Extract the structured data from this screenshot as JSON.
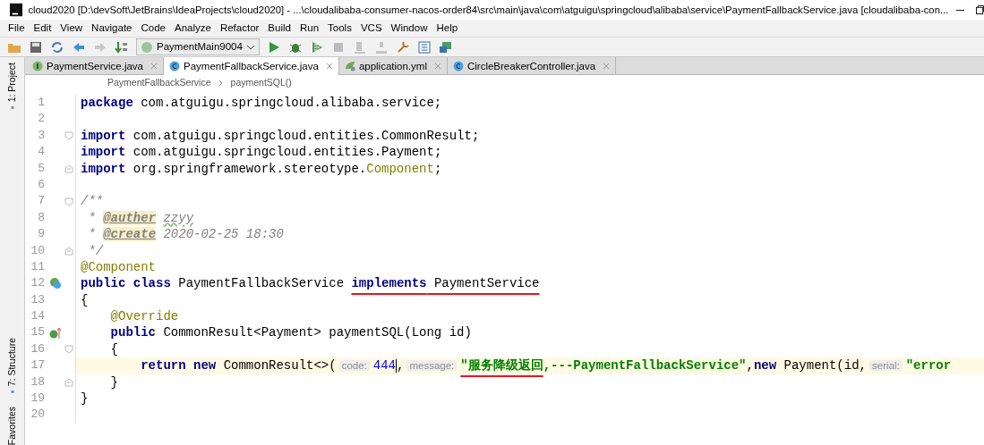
{
  "window": {
    "title": "cloud2020 [D:\\devSoft\\JetBrains\\IdeaProjects\\cloud2020] - ...\\cloudalibaba-consumer-nacos-order84\\src\\main\\java\\com\\atguigu\\springcloud\\alibaba\\service\\PaymentFallbackService.java [cloudalibaba-con..."
  },
  "menu": [
    "File",
    "Edit",
    "View",
    "Navigate",
    "Code",
    "Analyze",
    "Refactor",
    "Build",
    "Run",
    "Tools",
    "VCS",
    "Window",
    "Help"
  ],
  "toolbar": {
    "run_config": "PaymentMain9004"
  },
  "tool_stripe": [
    "1: Project",
    "7: Structure",
    "Favorites"
  ],
  "tabs": [
    {
      "label": "PaymentService.java",
      "kind": "interface",
      "selected": false
    },
    {
      "label": "PaymentFallbackService.java",
      "kind": "class",
      "selected": true
    },
    {
      "label": "application.yml",
      "kind": "yaml",
      "selected": false
    },
    {
      "label": "CircleBreakerController.java",
      "kind": "class",
      "selected": false
    }
  ],
  "breadcrumb": [
    "PaymentFallbackService",
    "paymentSQL()"
  ],
  "lines": [
    {
      "number": "1",
      "tokens": [
        {
          "kind": "kw",
          "text": "package"
        },
        {
          "kind": "plain",
          "text": " com.atguigu.springcloud.alibaba.service;"
        }
      ]
    },
    {
      "number": "2"
    },
    {
      "number": "3",
      "fold_start": true,
      "tokens": [
        {
          "kind": "kw",
          "text": "import"
        },
        {
          "kind": "plain",
          "text": " com.atguigu.springcloud.entities.CommonResult;"
        }
      ]
    },
    {
      "number": "4",
      "tokens": [
        {
          "kind": "kw",
          "text": "import"
        },
        {
          "kind": "plain",
          "text": " com.atguigu.springcloud.entities.Payment;"
        }
      ]
    },
    {
      "number": "5",
      "fold_end": true,
      "tokens": [
        {
          "kind": "kw",
          "text": "import"
        },
        {
          "kind": "plain",
          "text": " org.springframework.stereotype."
        },
        {
          "kind": "ann",
          "text": "Component"
        },
        {
          "kind": "plain",
          "text": ";"
        }
      ]
    },
    {
      "number": "6"
    },
    {
      "number": "7",
      "fold_start": true,
      "tokens": [
        {
          "kind": "comment",
          "text": "/**"
        }
      ]
    },
    {
      "number": "8",
      "tokens": [
        {
          "kind": "comment",
          "text": " * "
        },
        {
          "kind": "doctag",
          "text": "@auther"
        },
        {
          "kind": "typo",
          "text": "zzyy"
        }
      ]
    },
    {
      "number": "9",
      "tokens": [
        {
          "kind": "comment",
          "text": " * "
        },
        {
          "kind": "doctag",
          "text": "@create"
        },
        {
          "kind": "comment",
          "text": " 2020-02-25 18:30"
        }
      ]
    },
    {
      "number": "10",
      "fold_end": true,
      "tokens": [
        {
          "kind": "comment",
          "text": " */"
        }
      ]
    },
    {
      "number": "11",
      "tokens": [
        {
          "kind": "ann",
          "text": "@Component"
        }
      ]
    },
    {
      "number": "12",
      "implemented": true,
      "tokens": [
        {
          "kind": "kw",
          "text": "public class"
        },
        {
          "kind": "plain",
          "text": " PaymentFallbackService "
        },
        {
          "kind": "kw",
          "text": "implements",
          "underlined": true
        },
        {
          "kind": "plain",
          "text": " PaymentService",
          "underlined": true
        }
      ]
    },
    {
      "number": "13",
      "tokens": [
        {
          "kind": "plain",
          "text": "{"
        }
      ]
    },
    {
      "number": "14",
      "tokens": [
        {
          "kind": "ann",
          "text": "    @Override"
        }
      ]
    },
    {
      "number": "15",
      "overrides": true,
      "tokens": [
        {
          "kind": "kw",
          "text": "    public"
        },
        {
          "kind": "plain",
          "text": " CommonResult<Payment> paymentSQL(Long id)"
        }
      ]
    },
    {
      "number": "16",
      "fold_start": true,
      "tokens": [
        {
          "kind": "plain",
          "text": "    {"
        }
      ]
    },
    {
      "number": "17",
      "current": true,
      "tokens": [
        {
          "kind": "kw",
          "text": "        return new"
        },
        {
          "kind": "plain",
          "text": " CommonResult<>("
        },
        {
          "kind": "hint",
          "text": "code:"
        },
        {
          "kind": "number",
          "text": "444"
        },
        {
          "kind": "caret"
        },
        {
          "kind": "plain",
          "text": ","
        },
        {
          "kind": "hint",
          "text": "message:"
        },
        {
          "kind": "string",
          "text": "\"服务降级返回",
          "underlined": true
        },
        {
          "kind": "string",
          "text": ",---PaymentFallbackService\""
        },
        {
          "kind": "plain",
          "text": ","
        },
        {
          "kind": "kw",
          "text": "new"
        },
        {
          "kind": "plain",
          "text": " Payment(id,"
        },
        {
          "kind": "hint",
          "text": "serial:"
        },
        {
          "kind": "string",
          "text": "\"error"
        }
      ]
    },
    {
      "number": "18",
      "fold_end": true,
      "tokens": [
        {
          "kind": "plain",
          "text": "    }"
        }
      ]
    },
    {
      "number": "19",
      "tokens": [
        {
          "kind": "plain",
          "text": "}"
        }
      ]
    },
    {
      "number": "20"
    }
  ]
}
